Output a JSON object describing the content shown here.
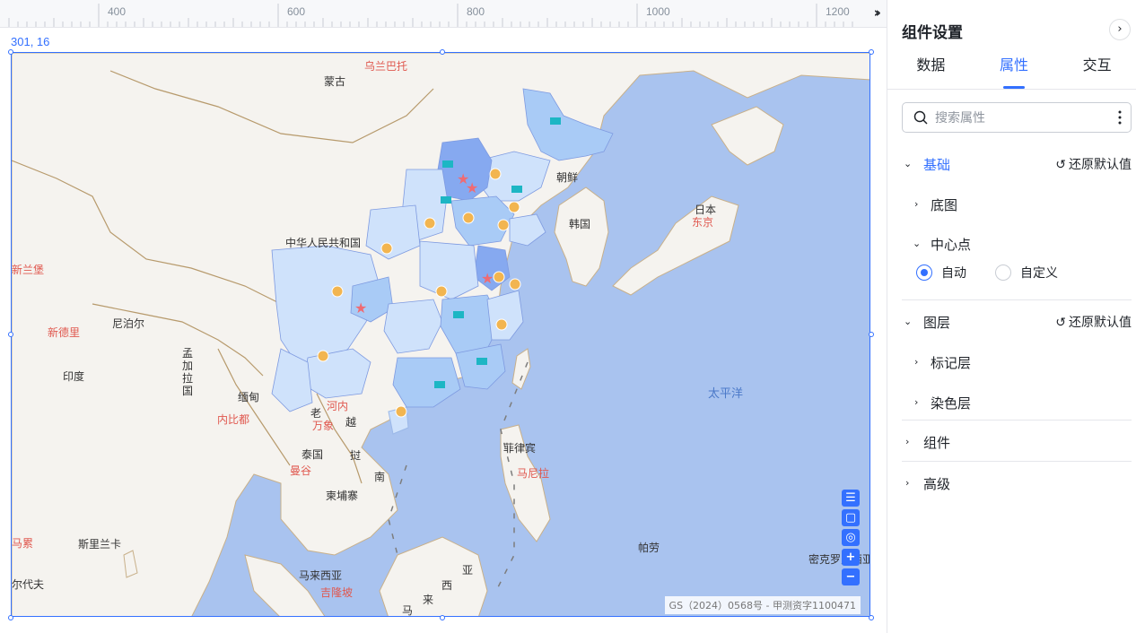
{
  "ruler": {
    "ticks": [
      "400",
      "600",
      "800",
      "1000",
      "1200"
    ],
    "toggle_icon": "double-chevron-right-icon"
  },
  "canvas": {
    "coord_readout": "301, 16"
  },
  "map": {
    "labels": {
      "ulaanbaatar": "乌兰巴托",
      "mongolia": "蒙古",
      "north_korea": "朝鲜",
      "south_korea": "韩国",
      "japan": "日本",
      "tokyo": "东京",
      "china": "中华人民共和国",
      "islamabad": "新兰堡",
      "new_delhi": "新德里",
      "nepal": "尼泊尔",
      "india": "印度",
      "bangladesh": "孟加拉国",
      "myanmar": "缅甸",
      "naypyidaw": "内比都",
      "hanoi": "河内",
      "laos": "老",
      "vientiane": "万象",
      "vietnam": "越",
      "thailand": "泰国",
      "bangkok": "曼谷",
      "cambodia": "柬埔寨",
      "south": "南",
      "vietnam_mid": "挝",
      "philippines": "菲律宾",
      "manila": "马尼拉",
      "pacific": "太平洋",
      "sri_lanka": "斯里兰卡",
      "male": "马累",
      "maldives": "尔代夫",
      "malaysia": "马来西亚",
      "kuala_lumpur": "吉隆坡",
      "palau": "帕劳",
      "micronesia": "密克罗尼西亚",
      "xi": "西",
      "ya": "亚",
      "lai": "来",
      "ma": "马"
    },
    "controls": [
      "list-icon",
      "fullscreen-icon",
      "locate-icon",
      "zoom-in-icon",
      "zoom-out-icon"
    ],
    "copyright": "GS（2024）0568号 - 甲测资字1100471"
  },
  "panel": {
    "title": "组件设置",
    "tabs": [
      {
        "label": "数据",
        "active": false
      },
      {
        "label": "属性",
        "active": true
      },
      {
        "label": "交互",
        "active": false
      }
    ],
    "search": {
      "placeholder": "搜索属性"
    },
    "sections": {
      "basic": {
        "label": "基础",
        "reset": "还原默认值"
      },
      "basemap": "底图",
      "center": "中心点",
      "center_options": [
        "自动",
        "自定义"
      ],
      "center_selected": "自动",
      "layers": {
        "label": "图层",
        "reset": "还原默认值"
      },
      "marker_layer": "标记层",
      "color_layer": "染色层",
      "component": "组件",
      "advanced": "高级"
    }
  },
  "colors": {
    "accent": "#3370ff",
    "ocean": "#a9c3ef",
    "land": "#f5f3ef",
    "province_light": "#cfe2fb",
    "province_mid": "#a9cbf6",
    "province_dark": "#86a9f0",
    "marker_pin": "#f2b550",
    "marker_star": "#ef6b73",
    "marker_flag": "#1db6c4"
  }
}
